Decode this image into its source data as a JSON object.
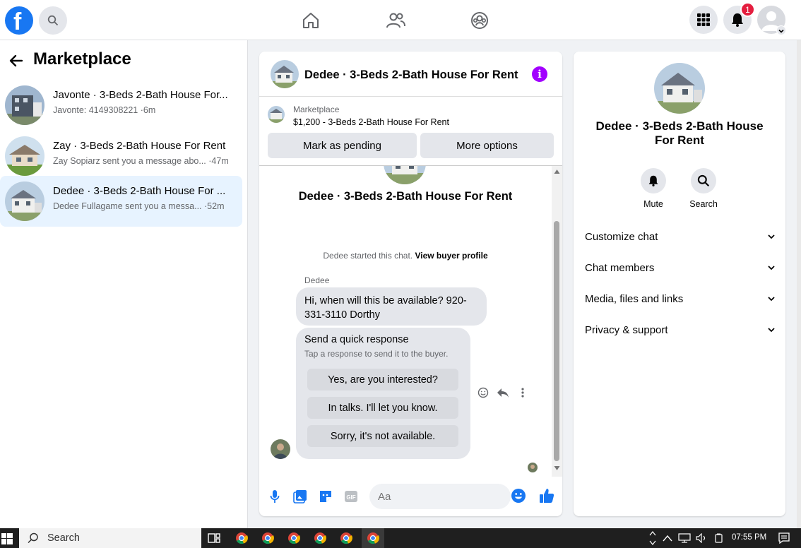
{
  "topbar": {
    "logo": "f",
    "notifications_count": "1"
  },
  "sidebar": {
    "title": "Marketplace",
    "conversations": [
      {
        "title": "Javonte · 3-Beds 2-Bath House For...",
        "subtitle": "Javonte: 4149308221 ·6m",
        "active": false
      },
      {
        "title": "Zay · 3-Beds 2-Bath House For Rent",
        "subtitle": "Zay Sopiarz sent you a message abo... ·47m",
        "active": false
      },
      {
        "title": "Dedee · 3-Beds 2-Bath House For ...",
        "subtitle": "Dedee Fullagame sent you a messa...   ·52m",
        "active": true
      }
    ]
  },
  "chat": {
    "header_title": "Dedee · 3-Beds 2-Bath House For Rent",
    "marketplace_label": "Marketplace",
    "listing": "$1,200 - 3-Beds 2-Bath House For Rent",
    "mark_pending": "Mark as pending",
    "more_options": "More options",
    "area_title": "Dedee · 3-Beds 2-Bath House For Rent",
    "started_text": "Dedee started this chat.",
    "view_profile": "View buyer profile",
    "sender_name": "Dedee",
    "message": "Hi, when will this be available? 920-331-3110 Dorthy",
    "quick_title": "Send a quick response",
    "quick_sub": "Tap a response to send it to the buyer.",
    "quick_options": [
      "Yes, are you interested?",
      "In talks. I'll let you know.",
      "Sorry, it's not available."
    ],
    "composer_placeholder": "Aa"
  },
  "info_panel": {
    "title": "Dedee · 3-Beds 2-Bath House For Rent",
    "actions": [
      "Mute",
      "Search"
    ],
    "sections": [
      "Customize chat",
      "Chat members",
      "Media, files and links",
      "Privacy & support"
    ]
  },
  "taskbar": {
    "search": "Search",
    "time": "07:55 PM"
  },
  "colors": {
    "brand": "#1877f2",
    "active_row": "#e7f3ff",
    "info_icon": "#a200ff",
    "badge": "#e41e3f"
  }
}
